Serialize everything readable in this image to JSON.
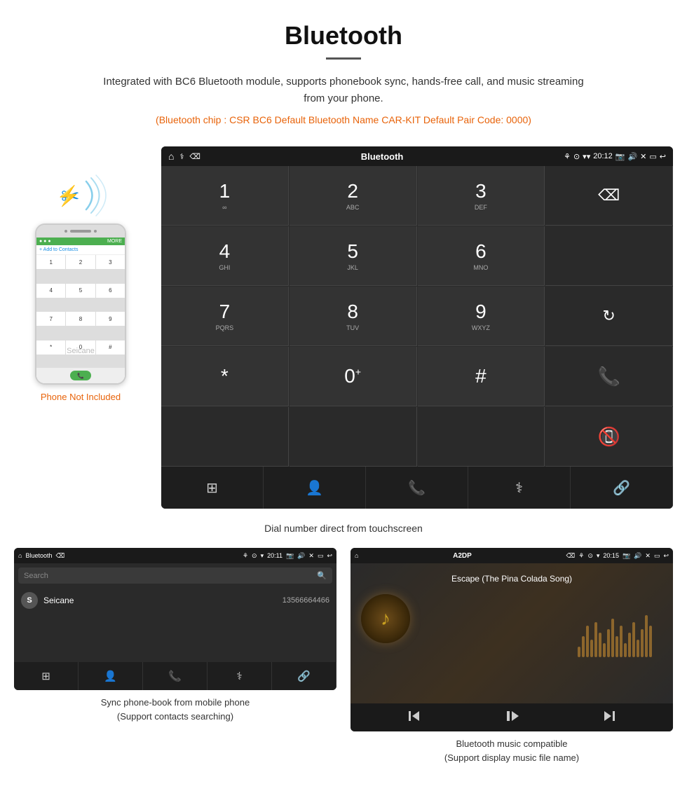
{
  "header": {
    "title": "Bluetooth",
    "description": "Integrated with BC6 Bluetooth module, supports phonebook sync, hands-free call, and music streaming from your phone.",
    "specs": "(Bluetooth chip : CSR BC6    Default Bluetooth Name CAR-KIT    Default Pair Code: 0000)"
  },
  "phone_section": {
    "not_included_label": "Phone Not Included",
    "watermark": "Seicane"
  },
  "car_screen_dial": {
    "status_bar": {
      "title": "Bluetooth",
      "time": "20:12"
    },
    "dialpad": [
      {
        "key": "1",
        "sub": "∞"
      },
      {
        "key": "2",
        "sub": "ABC"
      },
      {
        "key": "3",
        "sub": "DEF"
      },
      {
        "key": "delete",
        "sub": ""
      },
      {
        "key": "4",
        "sub": "GHI"
      },
      {
        "key": "5",
        "sub": "JKL"
      },
      {
        "key": "6",
        "sub": "MNO"
      },
      {
        "key": "",
        "sub": ""
      },
      {
        "key": "7",
        "sub": "PQRS"
      },
      {
        "key": "8",
        "sub": "TUV"
      },
      {
        "key": "9",
        "sub": "WXYZ"
      },
      {
        "key": "reload",
        "sub": ""
      },
      {
        "key": "*",
        "sub": ""
      },
      {
        "key": "0+",
        "sub": ""
      },
      {
        "key": "#",
        "sub": ""
      },
      {
        "key": "call",
        "sub": ""
      },
      {
        "key": "endcall",
        "sub": ""
      }
    ],
    "bottom_nav": [
      "grid",
      "person",
      "phone",
      "bluetooth",
      "link"
    ]
  },
  "dial_caption": "Dial number direct from touchscreen",
  "phonebook_screen": {
    "status_bar": {
      "title": "Bluetooth",
      "time": "20:11"
    },
    "search_placeholder": "Search",
    "contacts": [
      {
        "initial": "S",
        "name": "Seicane",
        "number": "13566664466"
      }
    ],
    "bottom_nav": [
      "grid",
      "person",
      "phone",
      "bluetooth",
      "link"
    ]
  },
  "phonebook_caption": "Sync phone-book from mobile phone\n(Support contacts searching)",
  "a2dp_screen": {
    "status_bar": {
      "title": "A2DP",
      "time": "20:15"
    },
    "song_title": "Escape (The Pina Colada Song)",
    "controls": [
      "prev",
      "play-pause",
      "next"
    ]
  },
  "a2dp_caption": "Bluetooth music compatible\n(Support display music file name)",
  "colors": {
    "orange": "#e8630a",
    "green": "#4caf50",
    "red": "#e53935",
    "blue": "#1a8fe3",
    "dark_bg": "#2a2a2a",
    "darker_bg": "#1a1a1a"
  }
}
